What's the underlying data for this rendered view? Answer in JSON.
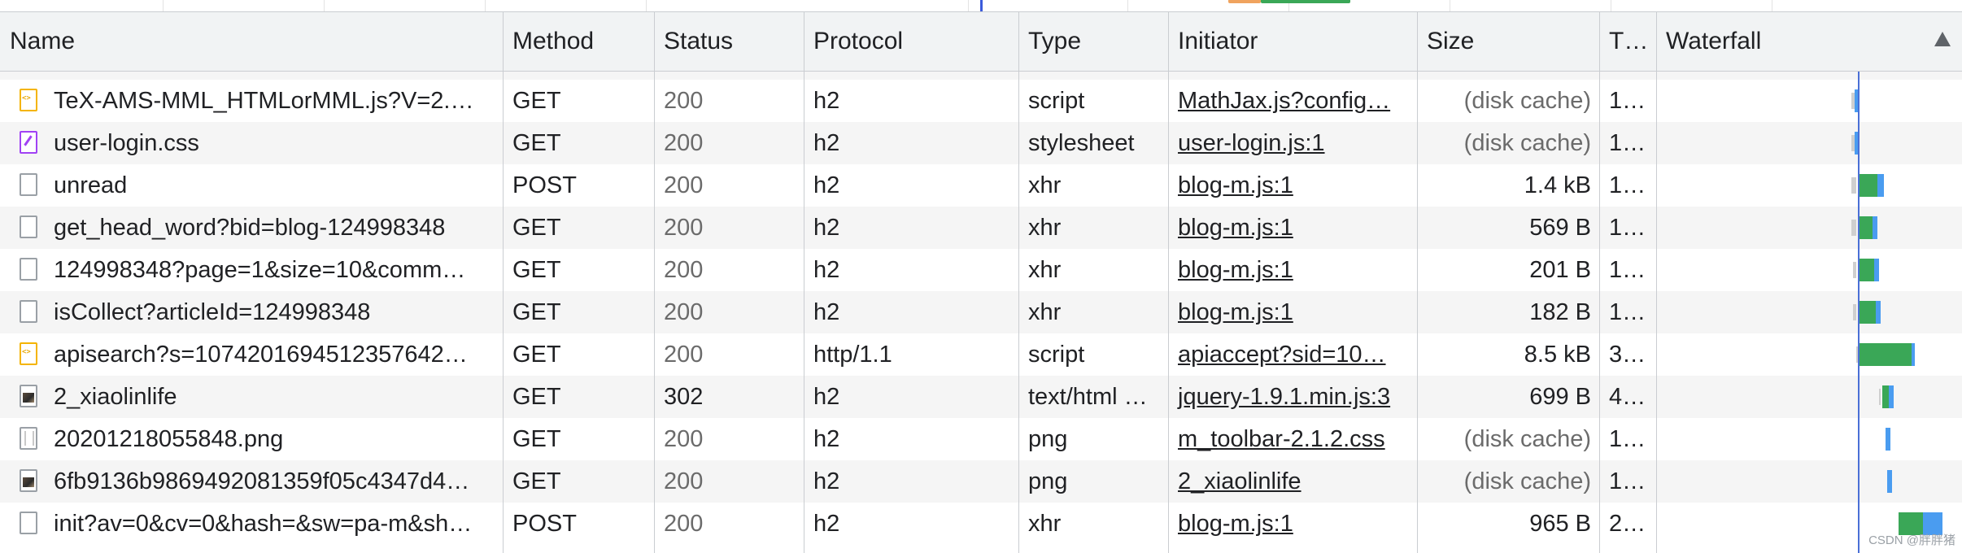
{
  "columns": {
    "name": "Name",
    "method": "Method",
    "status": "Status",
    "protocol": "Protocol",
    "type": "Type",
    "initiator": "Initiator",
    "size": "Size",
    "time": "T…",
    "waterfall": "Waterfall"
  },
  "rows": [
    {
      "icon": "script-file-icon",
      "name": "TeX-AMS-MML_HTMLorMML.js?V=2.…",
      "method": "GET",
      "status": "200",
      "protocol": "h2",
      "type": "script",
      "initiator": "MathJax.js?config…",
      "size": "(disk cache)",
      "time": "1…"
    },
    {
      "icon": "stylesheet-file-icon",
      "name": "user-login.css",
      "method": "GET",
      "status": "200",
      "protocol": "h2",
      "type": "stylesheet",
      "initiator": "user-login.js:1",
      "size": "(disk cache)",
      "time": "1…"
    },
    {
      "icon": "document-file-icon",
      "name": "unread",
      "method": "POST",
      "status": "200",
      "protocol": "h2",
      "type": "xhr",
      "initiator": "blog-m.js:1",
      "size": "1.4 kB",
      "time": "1…"
    },
    {
      "icon": "document-file-icon",
      "name": "get_head_word?bid=blog-124998348",
      "method": "GET",
      "status": "200",
      "protocol": "h2",
      "type": "xhr",
      "initiator": "blog-m.js:1",
      "size": "569 B",
      "time": "1…"
    },
    {
      "icon": "document-file-icon",
      "name": "124998348?page=1&size=10&comm…",
      "method": "GET",
      "status": "200",
      "protocol": "h2",
      "type": "xhr",
      "initiator": "blog-m.js:1",
      "size": "201 B",
      "time": "1…"
    },
    {
      "icon": "document-file-icon",
      "name": "isCollect?articleId=124998348",
      "method": "GET",
      "status": "200",
      "protocol": "h2",
      "type": "xhr",
      "initiator": "blog-m.js:1",
      "size": "182 B",
      "time": "1…"
    },
    {
      "icon": "script-file-icon",
      "name": "apisearch?s=107420169451235764​2…",
      "method": "GET",
      "status": "200",
      "protocol": "http/1.1",
      "type": "script",
      "initiator": "apiaccept?sid=10…",
      "size": "8.5 kB",
      "time": "3…"
    },
    {
      "icon": "image-file-icon",
      "name": "2_xiaolinlife",
      "method": "GET",
      "status": "302",
      "protocol": "h2",
      "type": "text/html …",
      "initiator": "jquery-1.9.1.min.js:3",
      "size": "699 B",
      "time": "4…"
    },
    {
      "icon": "png-file-icon",
      "name": "20201218055848.png",
      "method": "GET",
      "status": "200",
      "protocol": "h2",
      "type": "png",
      "initiator": "m_toolbar-2.1.2.css",
      "size": "(disk cache)",
      "time": "1…"
    },
    {
      "icon": "image-file-icon",
      "name": "6fb9136b9869492081359f05c4347d4…",
      "method": "GET",
      "status": "200",
      "protocol": "h2",
      "type": "png",
      "initiator": "2_xiaolinlife",
      "size": "(disk cache)",
      "time": "1…"
    },
    {
      "icon": "document-file-icon",
      "name": "init?av=0&cv=0&hash=&sw=pa-m&sh…",
      "method": "POST",
      "status": "200",
      "protocol": "h2",
      "type": "xhr",
      "initiator": "blog-m.js:1",
      "size": "965 B",
      "time": "2…"
    }
  ],
  "watermark": "CSDN @胖胖猪",
  "colors": {
    "header_bg": "#f1f3f4",
    "stripe_bg": "#f5f5f5",
    "border": "#cacdd1",
    "waterfall_waiting": "#3aa757",
    "waterfall_download": "#4a9cf0",
    "waterfall_marker": "#4a6fd6"
  }
}
